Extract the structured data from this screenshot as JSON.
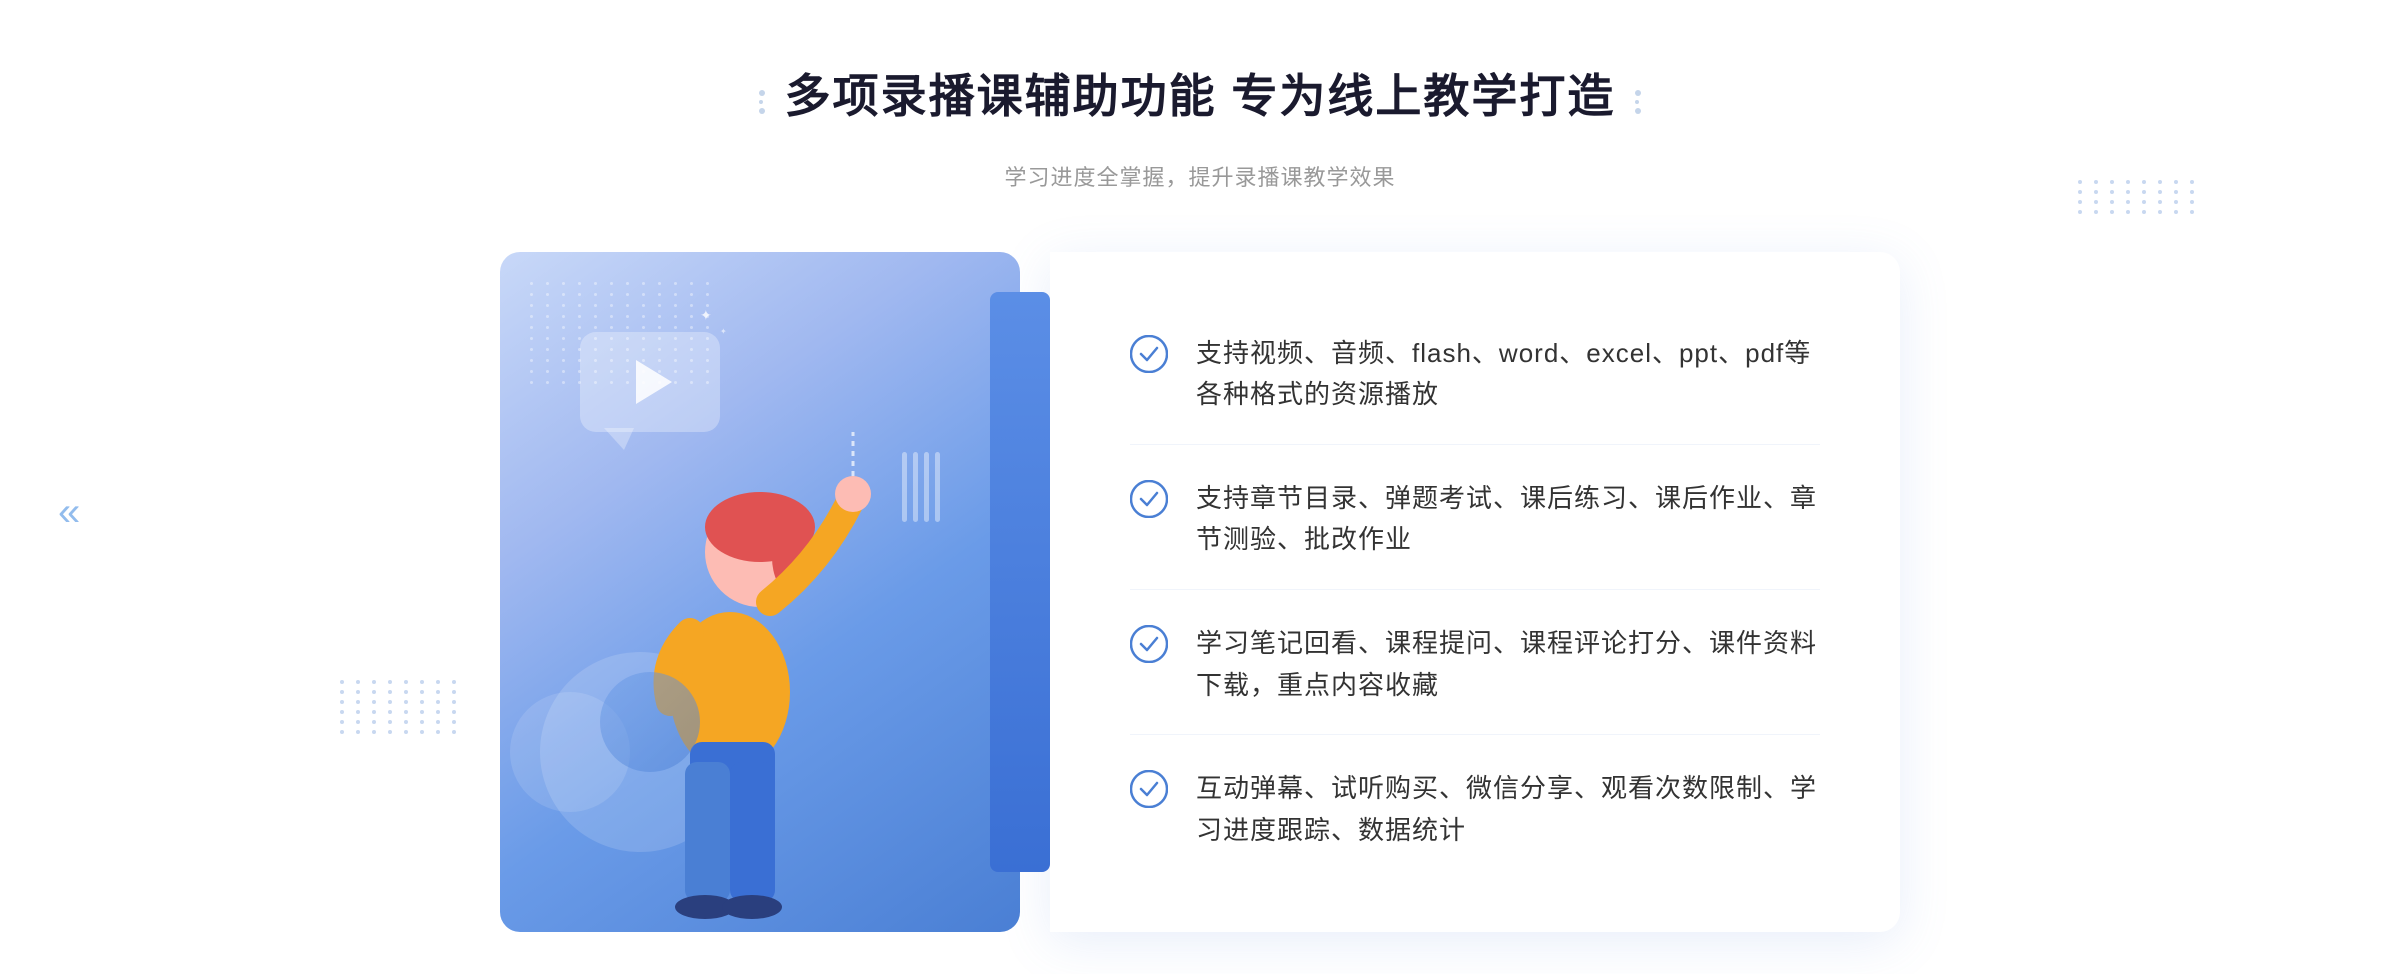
{
  "header": {
    "title": "多项录播课辅助功能 专为线上教学打造",
    "subtitle": "学习进度全掌握，提升录播课教学效果"
  },
  "features": [
    {
      "id": "feature-1",
      "text": "支持视频、音频、flash、word、excel、ppt、pdf等各种格式的资源播放"
    },
    {
      "id": "feature-2",
      "text": "支持章节目录、弹题考试、课后练习、课后作业、章节测验、批改作业"
    },
    {
      "id": "feature-3",
      "text": "学习笔记回看、课程提问、课程评论打分、课件资料下载，重点内容收藏"
    },
    {
      "id": "feature-4",
      "text": "互动弹幕、试听购买、微信分享、观看次数限制、学习进度跟踪、数据统计"
    }
  ],
  "icons": {
    "check": "✓",
    "play": "▶",
    "chevron_left": "«"
  },
  "colors": {
    "accent_blue": "#4a7fd4",
    "light_blue": "#c8d8f8",
    "text_dark": "#1a1a2e",
    "text_gray": "#999999",
    "text_body": "#333333"
  }
}
